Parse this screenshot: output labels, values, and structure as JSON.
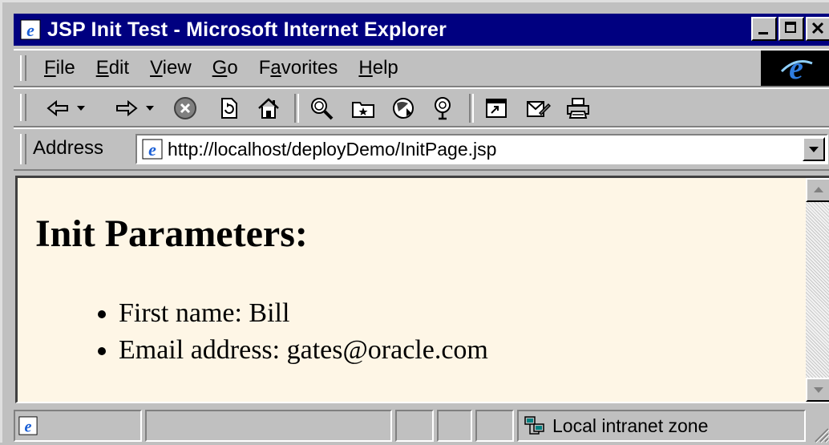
{
  "window": {
    "title": "JSP Init Test - Microsoft Internet Explorer",
    "controls": [
      "minimize-icon",
      "maximize-icon",
      "close-icon"
    ]
  },
  "menubar": {
    "items": [
      {
        "label": "File",
        "accel": "F"
      },
      {
        "label": "Edit",
        "accel": "E"
      },
      {
        "label": "View",
        "accel": "V"
      },
      {
        "label": "Go",
        "accel": "G"
      },
      {
        "label": "Favorites",
        "accel": "a"
      },
      {
        "label": "Help",
        "accel": "H"
      }
    ],
    "logo": "ie-logo-icon"
  },
  "toolbar": {
    "buttons": [
      "back-icon",
      "forward-icon",
      "stop-icon",
      "refresh-icon",
      "home-icon",
      "search-icon",
      "favorites-icon",
      "history-icon",
      "channels-icon",
      "fullscreen-icon",
      "mail-icon",
      "print-icon"
    ]
  },
  "address": {
    "label": "Address",
    "url": "http://localhost/deployDemo/InitPage.jsp"
  },
  "page": {
    "heading": "Init Parameters:",
    "params": [
      "First name: Bill",
      "Email address: gates@oracle.com"
    ],
    "background": "#fef6e6"
  },
  "statusbar": {
    "zone": "Local intranet zone"
  },
  "colors": {
    "titlebar": "#000080",
    "chrome": "#c0c0c0"
  }
}
